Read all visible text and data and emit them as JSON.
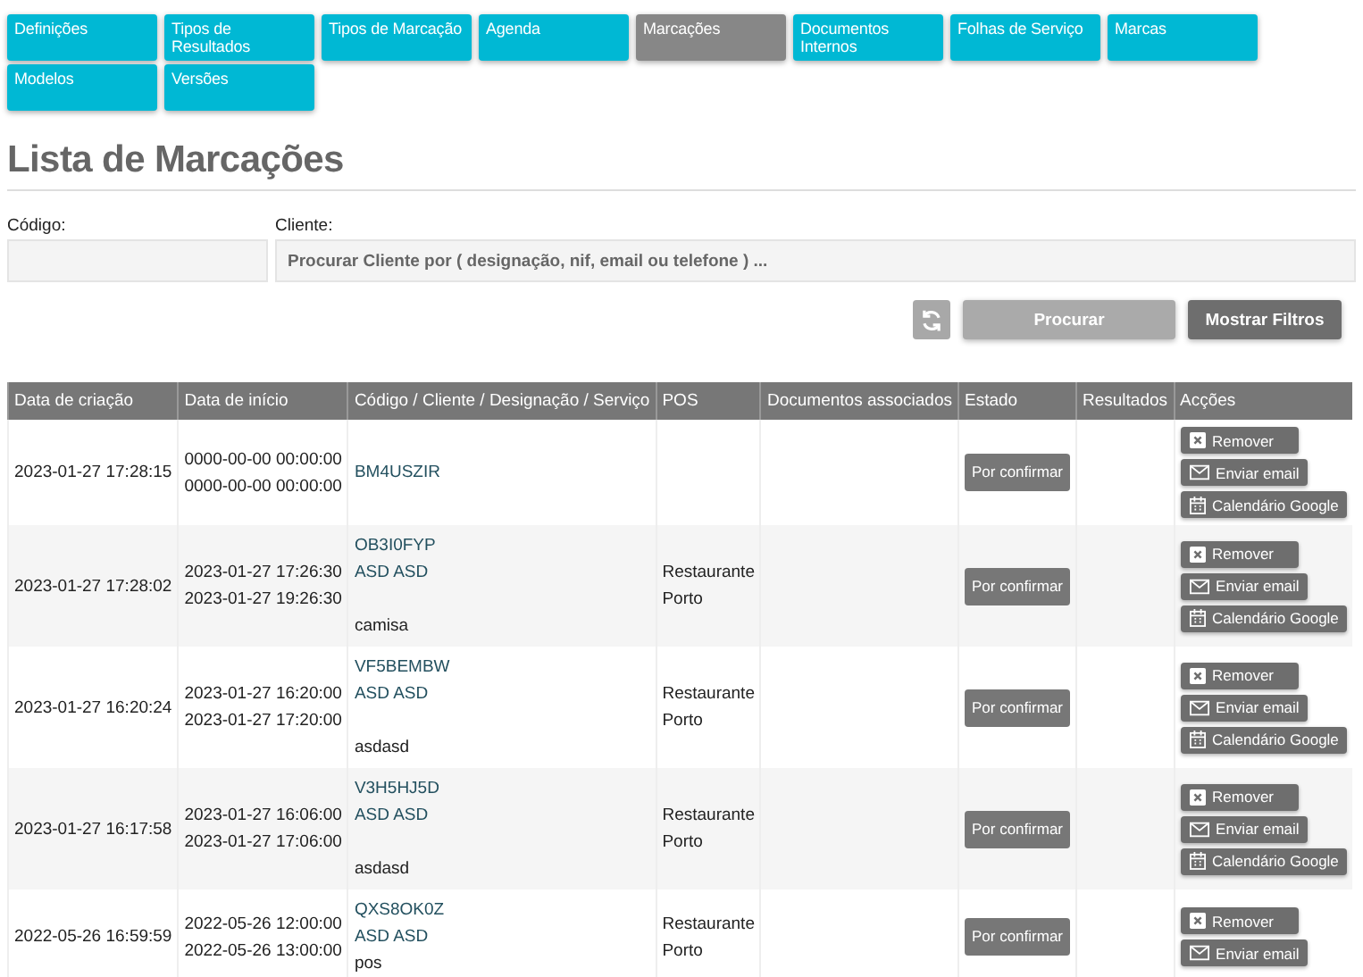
{
  "nav": [
    {
      "label": "Definições",
      "selected": false
    },
    {
      "label": "Tipos de Resultados",
      "selected": false
    },
    {
      "label": "Tipos de Marcação",
      "selected": false
    },
    {
      "label": "Agenda",
      "selected": false
    },
    {
      "label": "Marcações",
      "selected": true
    },
    {
      "label": "Documentos Internos",
      "selected": false
    },
    {
      "label": "Folhas de Serviço",
      "selected": false
    },
    {
      "label": "Marcas",
      "selected": false
    },
    {
      "label": "Modelos",
      "selected": false
    },
    {
      "label": "Versões",
      "selected": false
    }
  ],
  "title": "Lista de Marcações",
  "filters": {
    "code_label": "Código:",
    "client_label": "Cliente:",
    "client_placeholder": "Procurar Cliente por ( designação, nif, email ou telefone ) ...",
    "search_button": "Procurar",
    "filters_button": "Mostrar Filtros"
  },
  "table": {
    "columns": [
      "Data de criação",
      "Data de início",
      "Código / Cliente / Designação / Serviço",
      "POS",
      "Documentos associados",
      "Estado",
      "Resultados",
      "Acções"
    ],
    "rows": [
      {
        "created": "2023-01-27 17:28:15",
        "start": "0000-00-00 00:00:00",
        "end": "0000-00-00 00:00:00",
        "code": "BM4USZIR",
        "status": "Por confirmar",
        "actions": [
          "Remover",
          "Enviar email",
          "Calendário Google"
        ]
      },
      {
        "created": "2023-01-27 17:28:02",
        "start": "2023-01-27 17:26:30",
        "end": "2023-01-27 19:26:30",
        "code": "OB3I0FYP",
        "client": "ASD ASD",
        "service": "camisa",
        "pos": [
          "Restaurante",
          "Porto"
        ],
        "status": "Por confirmar",
        "actions": [
          "Remover",
          "Enviar email",
          "Calendário Google"
        ]
      },
      {
        "created": "2023-01-27 16:20:24",
        "start": "2023-01-27 16:20:00",
        "end": "2023-01-27 17:20:00",
        "code": "VF5BEMBW",
        "client": "ASD ASD",
        "service": "asdasd",
        "pos": [
          "Restaurante",
          "Porto"
        ],
        "status": "Por confirmar",
        "actions": [
          "Remover",
          "Enviar email",
          "Calendário Google"
        ]
      },
      {
        "created": "2023-01-27 16:17:58",
        "start": "2023-01-27 16:06:00",
        "end": "2023-01-27 17:06:00",
        "code": "V3H5HJ5D",
        "client": "ASD ASD",
        "service": "asdasd",
        "pos": [
          "Restaurante",
          "Porto"
        ],
        "status": "Por confirmar",
        "actions": [
          "Remover",
          "Enviar email",
          "Calendário Google"
        ]
      },
      {
        "created": "2022-05-26 16:59:59",
        "start": "2022-05-26 12:00:00",
        "end": "2022-05-26 13:00:00",
        "code": "QXS8OK0Z",
        "client": "ASD ASD",
        "designation": "pos",
        "pos": [
          "Restaurante",
          "Porto"
        ],
        "status": "Por confirmar",
        "actions": [
          "Remover",
          "Enviar email"
        ]
      }
    ]
  }
}
